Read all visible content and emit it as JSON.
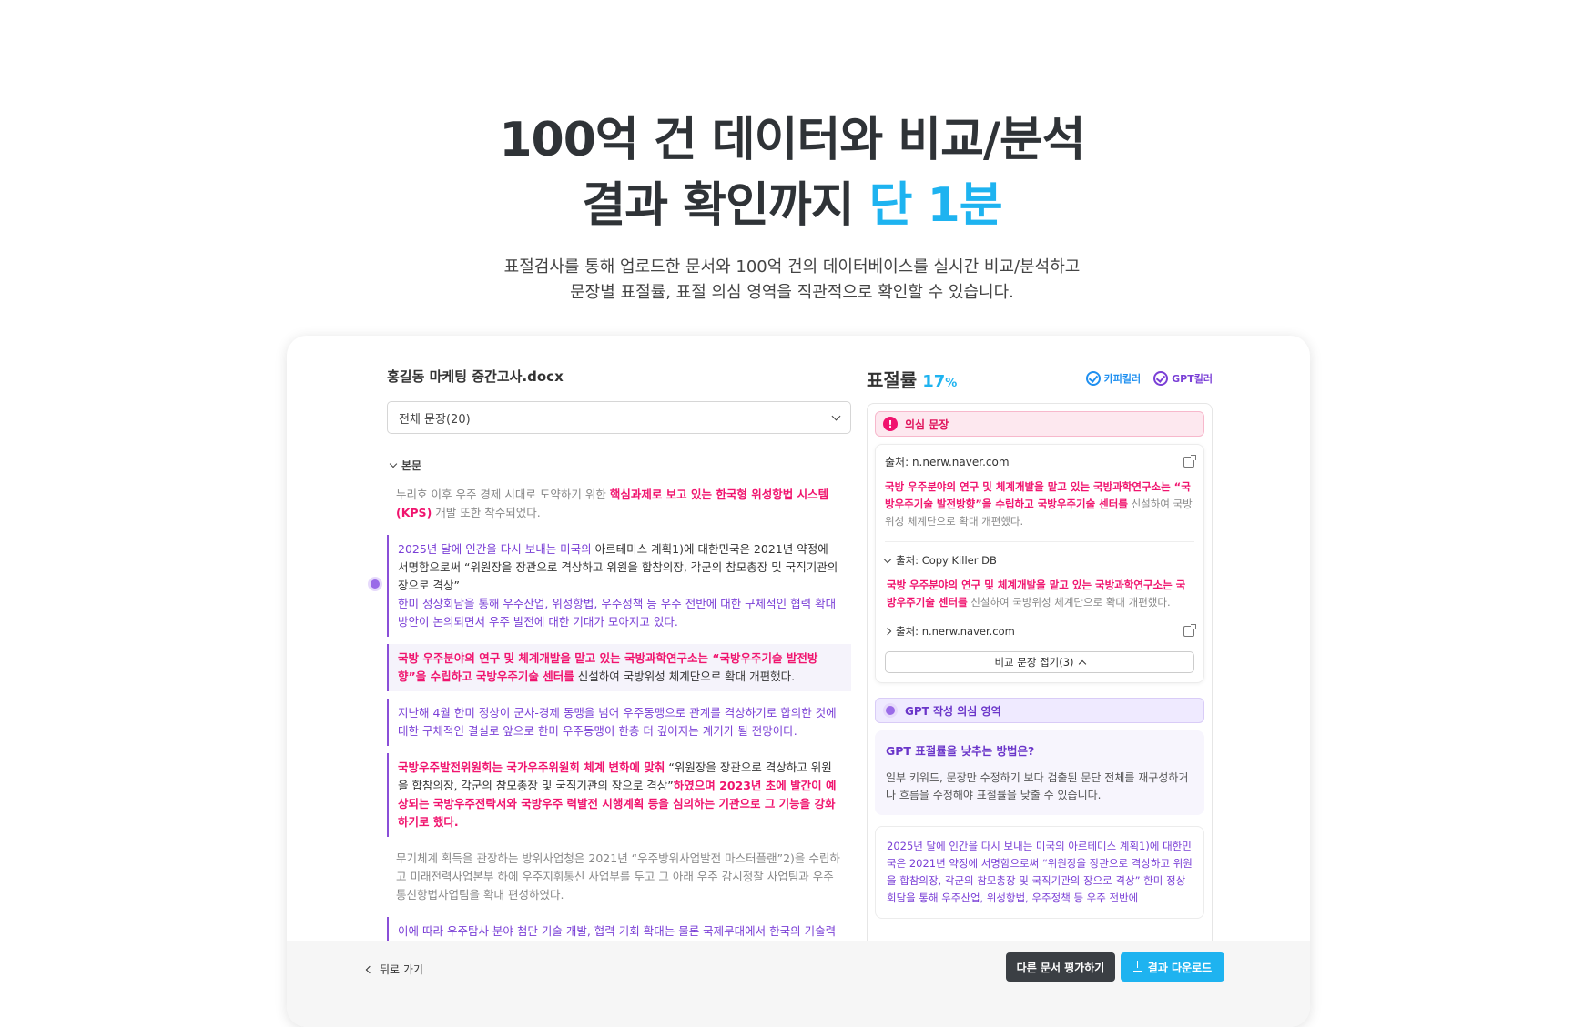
{
  "hero": {
    "line1": "100억 건 데이터와 비교/분석",
    "line2_prefix": "결과 확인까지 ",
    "line2_highlight": "단 1분",
    "desc1": "표절검사를 통해 업로드한 문서와 100억 건의 데이터베이스를 실시간 비교/분석하고",
    "desc2": "문장별 표절률, 표절 의심 영역을 직관적으로 확인할 수 있습니다."
  },
  "document": {
    "title": "홍길동 마케팅 중간고사.docx",
    "select_value": "전체 문장(20)",
    "section": "본문",
    "p1_gray": "누리호 이후 우주 경제 시대로 도약하기 위한 ",
    "p1_pink": "핵심과제로 보고 있는 한국형 위성항법 시스템(KPS)",
    "p1_tail": " 개발 또한 착수되었다.",
    "p2_purple": "2025년 달에 인간을 다시 보내는 미국의",
    "p2_dark": " 아르테미스 계획1)에 대한민국은 2021년 약정에 서명함으로써 “위원장을 장관으로 격상하고 위원을 합참의장, 각군의 참모총장 및 국직기관의 장으로 격상”",
    "p2_purple2": "한미 정상회담을 통해 우주산업, 위성항법, 우주정책 등 우주 전반에 대한 구체적인 협력 확대 방안이 논의되면서 우주 발전에 대한 기대가 모아지고 있다.",
    "p3_pink": "국방 우주분야의 연구 및 체계개발을 맡고 있는 국방과학연구소는 “국방우주기술 발전방향”을 수립하고 국방우주기술 센터를",
    "p3_dark": " 신설하여 국방위성 체계단으로 확대 개편했다.",
    "p4_purple": "지난해 4월 한미 정상이 군사-경제 동맹을 넘어 우주동맹으로 관계를 격상하기로 합의한 것에 대한 구체적인 결실로 앞으로 한미 우주동맹이 한층 더 깊어지는 계기가 될 전망이다.",
    "p5_pink": "국방우주발전위원회는 국가우주위원회 체계 변화에 맞춰",
    "p5_dark": " “위원장을 장관으로 격상하고 위원을 합참의장, 각군의 참모총장 및 국직기관의 장으로 격상”",
    "p5_pink2": "하였으며 2023년 초에 발간이 예상되는 국방우주전략서와 국방우주 력발전 시행계획 등을 심의하는 기관으로 그 기능을 강화하기로 했다.",
    "p6_gray": "무기체계 획득을 관장하는 방위사업청은 2021년 “우주방위사업발전 마스터플랜”2)을 수립하고 미래전력사업본부 하에 우주지휘통신 사업부를 두고 그 아래 우주 감시정찰 사업팀과 우주통신항법사업팀을 확대 편성하였다.",
    "p7_purple": "이에 따라 우주탐사 분야 첨단 기술 개발, 협력 기회 확대는 물론 국제무대에서 한국의 기술력을 인정받을 수 있는 발판을 마련했다."
  },
  "result": {
    "rate_label": "표절률",
    "rate_value": "17",
    "rate_unit": "%",
    "badge_ck": "카피킬러",
    "badge_gpt": "GPT킬러",
    "sus_title": "의심 문장",
    "src1": "출처: n.nerw.naver.com",
    "src1_pink": "국방 우주분야의 연구 및 체계개발을 맡고 있는 국방과학연구소는 “국방우주기술 발전방향”을 수립하고 국방우주기술 센터를",
    "src1_gray": " 신설하여 국방위성 체계단으로 확대 개편했다.",
    "src2": "출처: Copy Killer DB",
    "src2_pink": "국방 우주분야의 연구 및 체계개발을 맡고 있는 국방과학연구소는 국방우주기술 센터를",
    "src2_gray": " 신설하여 국방위성 체계단으로 확대 개편했다.",
    "src3": "출처: n.nerw.naver.com",
    "fold_label": "비교 문장 접기(3)",
    "gpt_title": "GPT 작성 의심 영역",
    "tip_title": "GPT 표절률을 낮추는 방법은?",
    "tip_text": "일부 키워드, 문장만 수정하기 보다 검출된 문단 전체를 재구성하거나 흐름을 수정해야 표절률을 낮출 수 있습니다.",
    "gpt_text": "2025년 달에 인간을 다시 보내는 미국의 아르테미스 계획1)에 대한민국은 2021년 약정에 서명함으로써 “위원장을 장관으로 격상하고 위원을 합참의장, 각군의 참모총장 및 국직기관의 장으로 격상” 한미 정상회담을 통해 우주산업, 위성항법, 우주정책 등 우주 전반에"
  },
  "footer": {
    "back": "뒤로 가기",
    "other_doc": "다른 문서 평가하기",
    "download": "결과 다운로드"
  },
  "colors": {
    "accent_blue": "#1eb3f0",
    "pink": "#f0146e",
    "purple": "#7a3fd6"
  }
}
